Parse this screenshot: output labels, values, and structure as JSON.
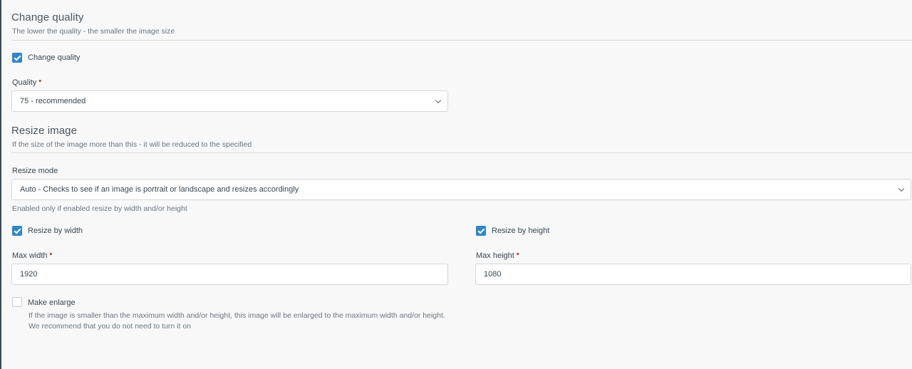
{
  "quality_section": {
    "title": "Change quality",
    "subtitle": "The lower the quality - the smaller the image size",
    "change_quality_label": "Change quality",
    "change_quality_checked": true,
    "quality_label": "Quality",
    "required_mark": "•",
    "quality_value": "75 - recommended"
  },
  "resize_section": {
    "title": "Resize image",
    "subtitle": "If the size of the image more than this - it will be reduced to the specified",
    "resize_mode_label": "Resize mode",
    "resize_mode_value": "Auto - Checks to see if an image is portrait or landscape and resizes accordingly",
    "resize_mode_help": "Enabled only if enabled resize by width and/or height",
    "resize_by_width_label": "Resize by width",
    "resize_by_width_checked": true,
    "resize_by_height_label": "Resize by height",
    "resize_by_height_checked": true,
    "max_width_label": "Max width",
    "max_width_value": "1920",
    "max_height_label": "Max height",
    "max_height_value": "1080",
    "make_enlarge_label": "Make enlarge",
    "make_enlarge_checked": false,
    "make_enlarge_help_1": "If the image is smaller than the maximum width and/or height, this image will be enlarged to the maximum width and/or height.",
    "make_enlarge_help_2": "We recommend that you do not need to turn it on"
  },
  "colors": {
    "accent": "#2f86c9",
    "required": "#c0282b",
    "background": "#f8f8f8"
  }
}
